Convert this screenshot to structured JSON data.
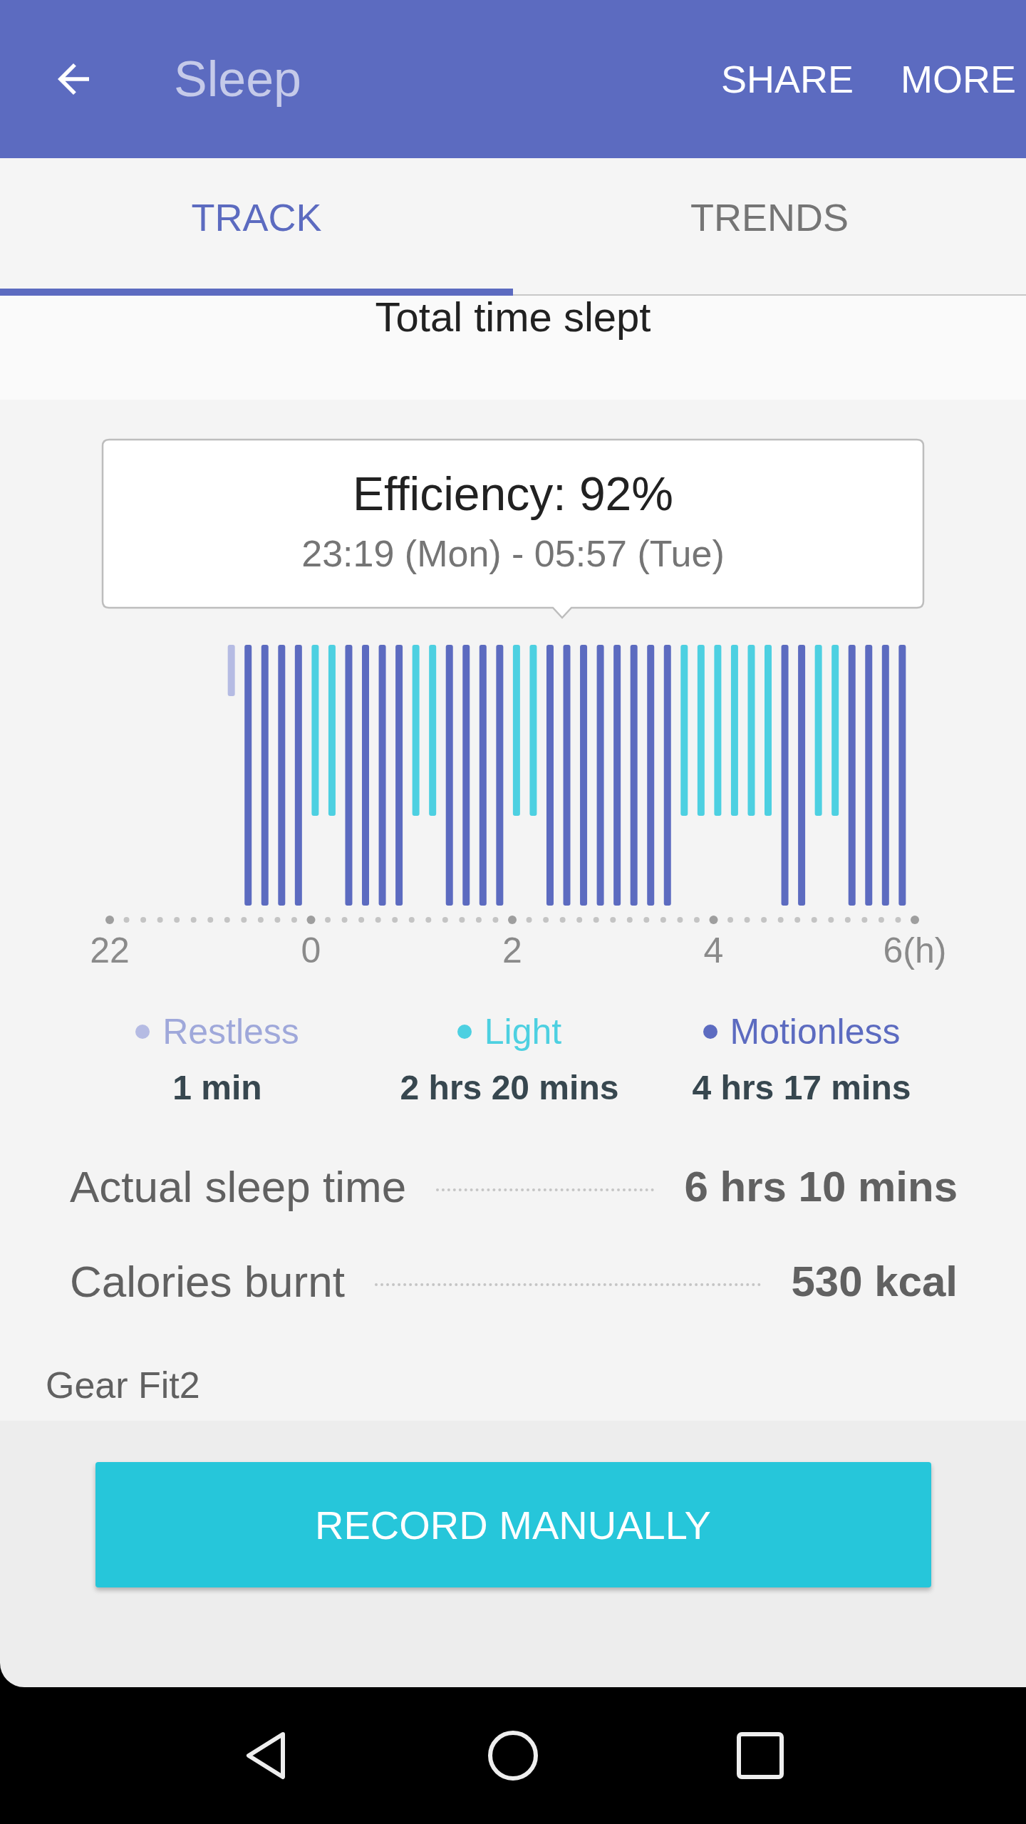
{
  "app_bar": {
    "title": "Sleep",
    "actions": [
      "SHARE",
      "MORE"
    ]
  },
  "tabs": [
    {
      "label": "TRACK",
      "selected": true
    },
    {
      "label": "TRENDS",
      "selected": false
    }
  ],
  "section_title": "Total time slept",
  "tooltip": {
    "title": "Efficiency: 92%",
    "range": "23:19 (Mon) - 05:57 (Tue)"
  },
  "sleep_graph": {
    "axis_labels": [
      "22",
      "0",
      "2",
      "4",
      "6(h)"
    ],
    "segments": [
      {
        "kind": "restless"
      },
      {
        "kind": "motionless"
      },
      {
        "kind": "motionless"
      },
      {
        "kind": "motionless"
      },
      {
        "kind": "motionless"
      },
      {
        "kind": "light"
      },
      {
        "kind": "light"
      },
      {
        "kind": "motionless"
      },
      {
        "kind": "motionless"
      },
      {
        "kind": "motionless"
      },
      {
        "kind": "motionless"
      },
      {
        "kind": "light"
      },
      {
        "kind": "light"
      },
      {
        "kind": "motionless"
      },
      {
        "kind": "motionless"
      },
      {
        "kind": "motionless"
      },
      {
        "kind": "motionless"
      },
      {
        "kind": "light"
      },
      {
        "kind": "light"
      },
      {
        "kind": "motionless"
      },
      {
        "kind": "motionless"
      },
      {
        "kind": "motionless"
      },
      {
        "kind": "motionless"
      },
      {
        "kind": "motionless"
      },
      {
        "kind": "motionless"
      },
      {
        "kind": "motionless"
      },
      {
        "kind": "motionless"
      },
      {
        "kind": "light"
      },
      {
        "kind": "light"
      },
      {
        "kind": "light"
      },
      {
        "kind": "light"
      },
      {
        "kind": "light"
      },
      {
        "kind": "light"
      },
      {
        "kind": "motionless"
      },
      {
        "kind": "motionless"
      },
      {
        "kind": "light"
      },
      {
        "kind": "light"
      },
      {
        "kind": "motionless"
      },
      {
        "kind": "motionless"
      },
      {
        "kind": "motionless"
      },
      {
        "kind": "motionless"
      }
    ]
  },
  "legend": [
    {
      "kind": "restless",
      "label": "Restless",
      "value": "1 min",
      "color": "#b5bbe3"
    },
    {
      "kind": "light",
      "label": "Light",
      "value": "2 hrs 20 mins",
      "color": "#4dd0e1"
    },
    {
      "kind": "motionless",
      "label": "Motionless",
      "value": "4 hrs 17 mins",
      "color": "#5c6bc0"
    }
  ],
  "stats": [
    {
      "label": "Actual sleep time",
      "value": "6 hrs 10 mins"
    },
    {
      "label": "Calories burnt",
      "value": "530 kcal"
    }
  ],
  "device": "Gear Fit2",
  "button": "RECORD MANUALLY"
}
